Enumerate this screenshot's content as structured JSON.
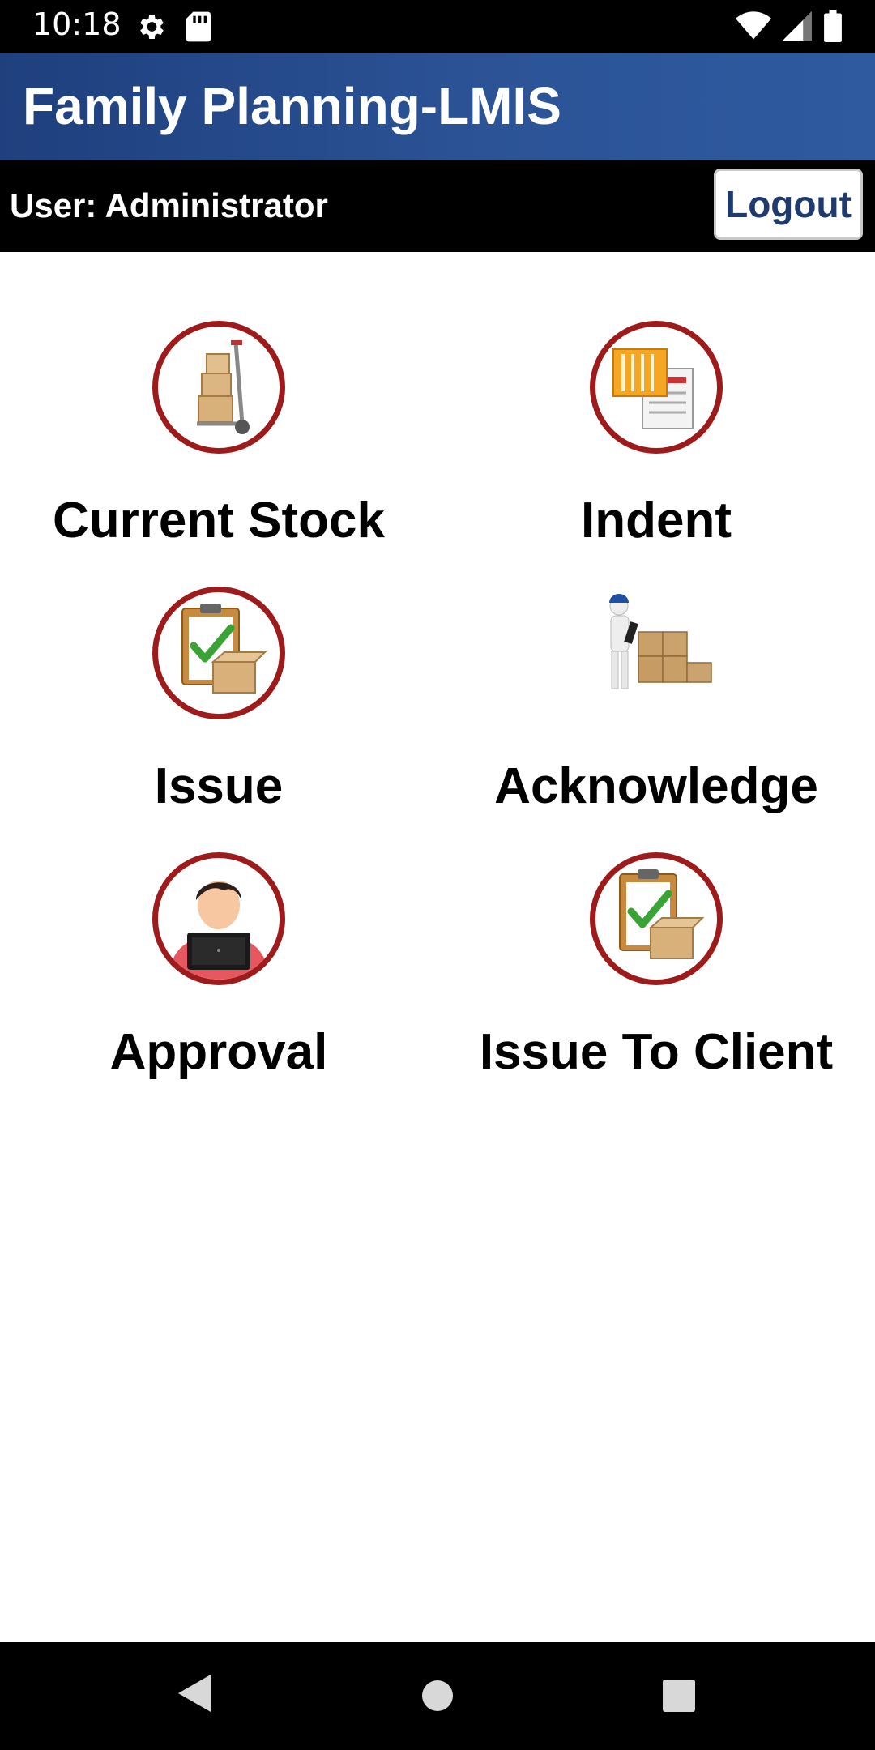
{
  "status_bar": {
    "time": "10:18",
    "left_icons": [
      "gear-icon",
      "sd-card-icon"
    ],
    "right_icons": [
      "wifi-icon",
      "signal-icon",
      "battery-icon"
    ]
  },
  "header": {
    "app_title": "Family Planning-LMIS",
    "user_label": "User: Administrator",
    "logout_label": "Logout"
  },
  "menu": {
    "items": [
      {
        "label": "Current Stock",
        "icon": "hand-truck-boxes-icon"
      },
      {
        "label": "Indent",
        "icon": "indent-document-icon"
      },
      {
        "label": "Issue",
        "icon": "clipboard-box-icon"
      },
      {
        "label": "Acknowledge",
        "icon": "worker-boxes-icon"
      },
      {
        "label": "Approval",
        "icon": "person-laptop-icon"
      },
      {
        "label": "Issue To Client",
        "icon": "clipboard-box-icon"
      }
    ]
  },
  "nav_bar": {
    "buttons": [
      "back-icon",
      "home-icon",
      "recents-icon"
    ]
  },
  "colors": {
    "header_blue": "#2b5396",
    "icon_ring_red": "#9e1b1b",
    "logout_text": "#1e3a6e"
  }
}
